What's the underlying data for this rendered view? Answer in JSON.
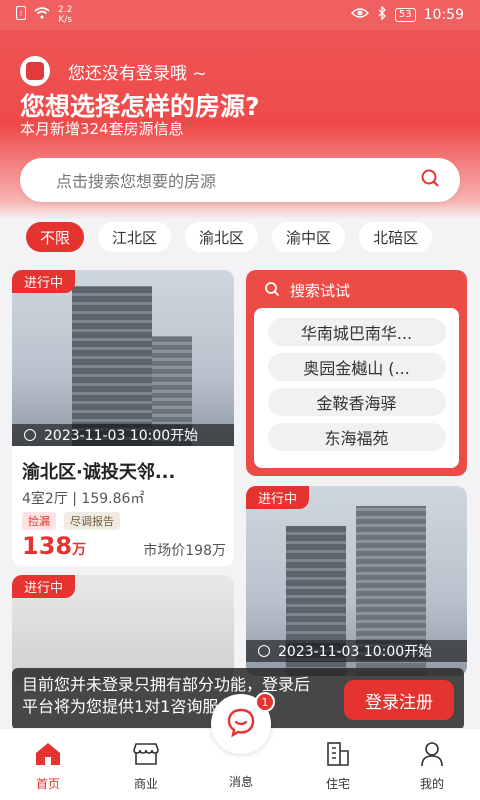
{
  "status_bar": {
    "speed_value": "2.2",
    "speed_unit": "K/s",
    "battery": "53",
    "time": "10:59"
  },
  "header": {
    "login_hint": "您还没有登录哦 ~",
    "headline": "您想选择怎样的房源?",
    "subline": "本月新增324套房源信息"
  },
  "search": {
    "placeholder": "点击搜索您想要的房源"
  },
  "districts": [
    "不限",
    "江北区",
    "渝北区",
    "渝中区",
    "北碚区"
  ],
  "cards": [
    {
      "status": "进行中",
      "time": "2023-11-03 10:00开始",
      "title": "渝北区·诚投天邻...",
      "spec": "4室2厅 | 159.86㎡",
      "badges": [
        "捡漏",
        "尽调报告"
      ],
      "price": "138",
      "price_unit": "万",
      "market": "市场价198万"
    },
    {
      "status": "进行中",
      "time": "2023-11-03 10:00开始"
    },
    {
      "status": "进行中"
    }
  ],
  "search_try": {
    "title": "搜索试试",
    "items": [
      "华南城巴南华...",
      "奥园金樾山 (...",
      "金鞍香海驿",
      "东海福苑"
    ]
  },
  "login_banner": {
    "text": "目前您并未登录只拥有部分功能，登录后平台将为您提供1对1咨询服务",
    "button": "登录注册"
  },
  "tabbar": {
    "items": [
      "首页",
      "商业",
      "消息",
      "住宅",
      "我的"
    ],
    "message_badge": "1"
  },
  "colors": {
    "accent": "#e5332f",
    "header": "#ef4a4a"
  }
}
